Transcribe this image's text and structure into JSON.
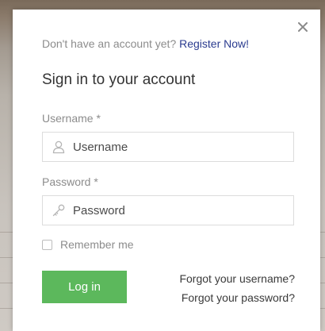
{
  "modal": {
    "register_prompt": "Don't have an account yet?",
    "register_link": "Register Now!",
    "title": "Sign in to your account",
    "close_icon": "close-icon"
  },
  "form": {
    "username_label": "Username *",
    "username_placeholder": "Username",
    "username_value": "",
    "password_label": "Password *",
    "password_placeholder": "Password",
    "password_value": "",
    "remember_label": "Remember me",
    "remember_checked": false,
    "login_label": "Log in",
    "forgot_username": "Forgot your username?",
    "forgot_password": "Forgot your password?"
  },
  "colors": {
    "login_button": "#5cb85c",
    "link": "#2a3b8f",
    "muted_text": "#8c8c8c"
  }
}
